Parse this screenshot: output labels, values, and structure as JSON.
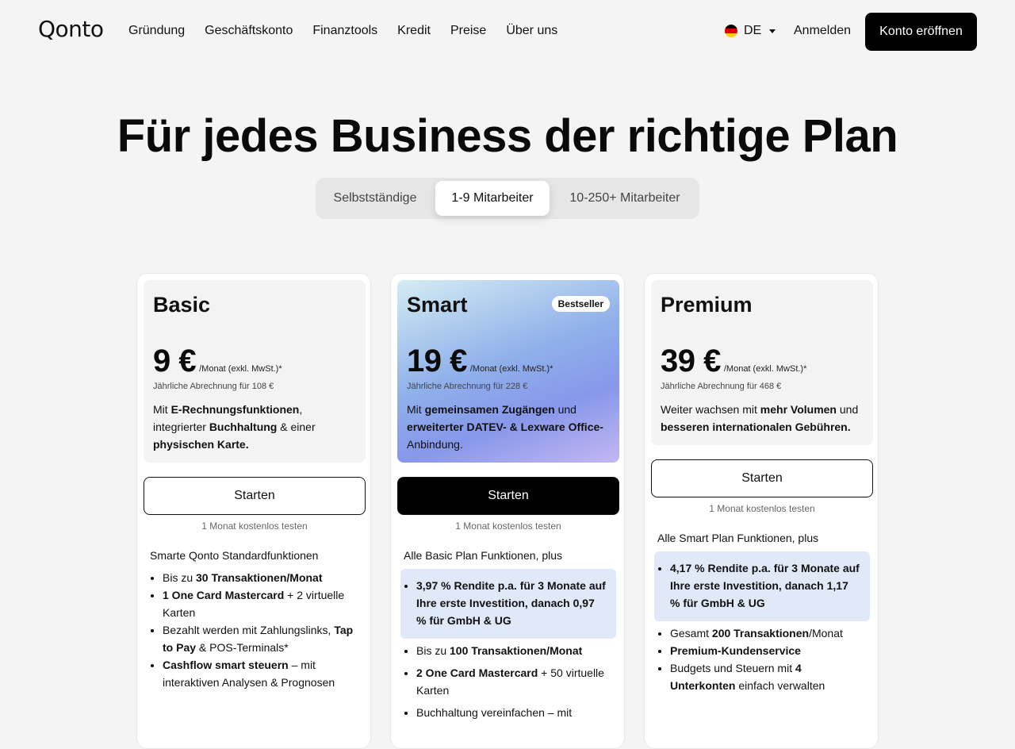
{
  "header": {
    "logo": "Qonto",
    "nav": [
      "Gründung",
      "Geschäftskonto",
      "Finanztools",
      "Kredit",
      "Preise",
      "Über uns"
    ],
    "language": "DE",
    "login": "Anmelden",
    "cta": "Konto eröffnen"
  },
  "hero": {
    "title": "Für jedes Business der richtige Plan",
    "tabs": [
      "Selbstständige",
      "1-9 Mitarbeiter",
      "10-250+ Mitarbeiter"
    ],
    "selected_tab": "1-9 Mitarbeiter"
  },
  "plans": [
    {
      "name": "Basic",
      "price": "9 €",
      "per": "/Monat (exkl. MwSt.)*",
      "billing": "Jährliche Abrechnung für 108 €",
      "desc_parts": [
        "Mit ",
        "E-Rechnungsfunktionen",
        ", integrierter ",
        "Buchhaltung",
        " & einer ",
        "physischen Karte."
      ],
      "button": "Starten",
      "trial": "1 Monat kostenlos testen",
      "features_head": "Smarte Qonto Standardfunktionen",
      "features": [
        [
          "Bis zu ",
          "30 Transaktionen/Monat",
          ""
        ],
        [
          "",
          "1 One Card Mastercard",
          " + 2 virtuelle Karten"
        ],
        [
          "Bezahlt werden mit Zahlungslinks, ",
          "Tap to Pay",
          " & POS-Terminals*"
        ],
        [
          "",
          "Cashflow smart steuern",
          " – mit interaktiven Analysen & Prognosen"
        ]
      ]
    },
    {
      "name": "Smart",
      "badge": "Bestseller",
      "price": "19 €",
      "per": "/Monat (exkl. MwSt.)*",
      "billing": "Jährliche Abrechnung für 228 €",
      "desc_parts": [
        "Mit ",
        "gemeinsamen Zugängen",
        " und ",
        "erweiterter DATEV- & Lexware Office-",
        "Anbindung."
      ],
      "button": "Starten",
      "trial": "1 Monat kostenlos testen",
      "features_head": "Alle Basic Plan Funktionen, plus",
      "highlight": "3,97 % Rendite p.a. für 3 Monate auf Ihre erste Investition, danach 0,97 % für GmbH & UG",
      "features": [
        [
          "Bis zu ",
          "100 Transaktionen/Monat",
          ""
        ],
        [
          "",
          "2 One Card Mastercard",
          " + 50 virtuelle Karten"
        ],
        [
          "Buchhaltung vereinfachen – mit",
          "",
          ""
        ]
      ]
    },
    {
      "name": "Premium",
      "price": "39 €",
      "per": "/Monat (exkl. MwSt.)*",
      "billing": "Jährliche Abrechnung für 468 €",
      "desc_parts": [
        "Weiter wachsen mit ",
        "mehr Volumen",
        " und ",
        "besseren internationalen Gebühren.",
        ""
      ],
      "button": "Starten",
      "trial": "1 Monat kostenlos testen",
      "features_head": "Alle Smart Plan Funktionen, plus",
      "highlight": "4,17 % Rendite p.a. für 3 Monate auf Ihre erste Investition, danach 1,17 % für GmbH & UG",
      "features": [
        [
          "Gesamt ",
          "200 Transaktionen",
          "/Monat"
        ],
        [
          "",
          "Premium-Kundenservice",
          ""
        ],
        [
          "Budgets und Steuern mit ",
          "4 Unterkonten",
          " einfach verwalten"
        ]
      ]
    }
  ],
  "colors": {
    "accent": "#000000",
    "background": "#f4f4f4",
    "highlight": "#e0e9f8"
  }
}
